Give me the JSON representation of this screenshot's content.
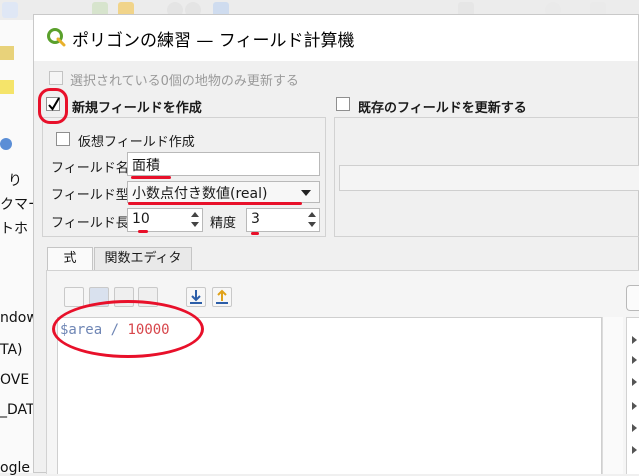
{
  "background": {
    "sidebar_fragments": [
      "り",
      "クマー",
      "トホ",
      "ndow",
      "TA)",
      "OVE",
      "_DAT",
      "ogle"
    ]
  },
  "dialog": {
    "title": "ポリゴンの練習 — フィールド計算機",
    "selected_only_label": "選択されている0個の地物のみ更新する",
    "create_new_label": "新規フィールドを作成",
    "create_new_checked": true,
    "virtual_label": "仮想フィールド作成",
    "update_existing_label": "既存のフィールドを更新する",
    "field_name_label": "フィールド名",
    "field_name_value": "面積",
    "field_type_label": "フィールド型",
    "field_type_value": "小数点付き数値(real)",
    "field_length_label": "フィールド長",
    "field_length_value": "10",
    "precision_label": "精度",
    "precision_value": "3",
    "tabs": [
      "式",
      "関数エディタ"
    ],
    "expression": {
      "variable": "$area",
      "operator": "/",
      "number": "10000"
    }
  },
  "colors": {
    "annotation": "#e8102a",
    "expression_variable": "#6f86b5",
    "expression_number": "#d7464b",
    "qgis_green": "#5aa02c"
  }
}
